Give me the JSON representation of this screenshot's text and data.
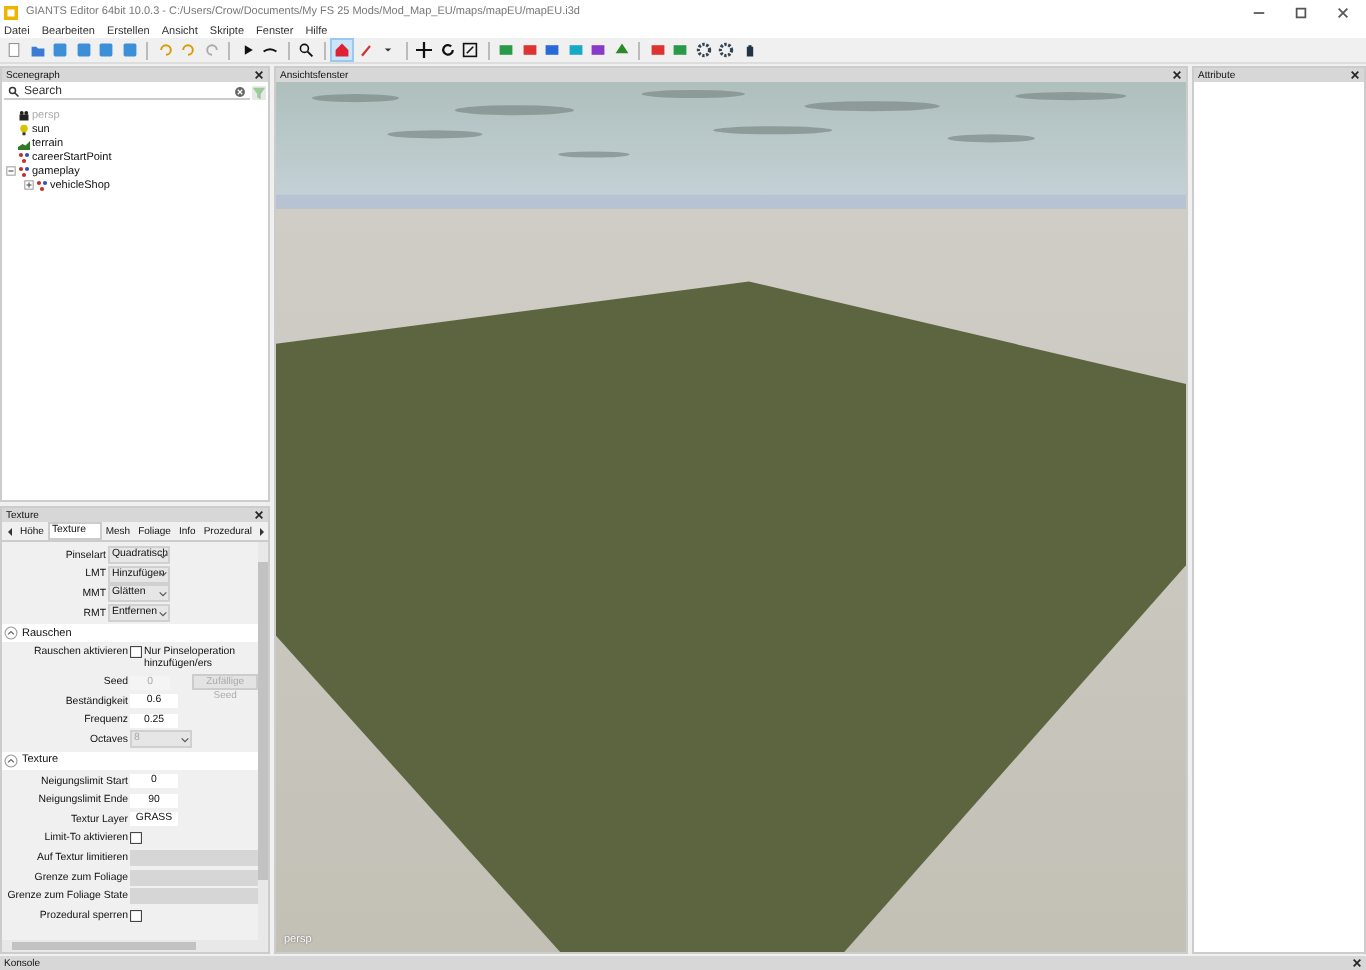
{
  "window": {
    "title": "GIANTS Editor 64bit 10.0.3 - C:/Users/Crow/Documents/My FS 25 Mods/Mod_Map_EU/maps/mapEU/mapEU.i3d"
  },
  "menu": [
    "Datei",
    "Bearbeiten",
    "Erstellen",
    "Ansicht",
    "Skripte",
    "Fenster",
    "Hilfe"
  ],
  "scenegraph": {
    "title": "Scenegraph",
    "search": {
      "placeholder": "Search"
    },
    "nodes": [
      {
        "label": "persp",
        "kind": "camera",
        "dimmed": true
      },
      {
        "label": "sun",
        "kind": "light",
        "dimmed": false
      },
      {
        "label": "terrain",
        "kind": "terrain",
        "dimmed": false
      },
      {
        "label": "careerStartPoint",
        "kind": "transform",
        "dimmed": false
      },
      {
        "label": "gameplay",
        "kind": "transform",
        "dimmed": false,
        "expanded": true,
        "children": [
          {
            "label": "vehicleShop",
            "kind": "transform",
            "dimmed": false,
            "expanded": false
          }
        ]
      }
    ]
  },
  "texture": {
    "title": "Texture",
    "tabs": [
      {
        "label": "Höhe",
        "selected": false
      },
      {
        "label": "Texture",
        "selected": true
      },
      {
        "label": "Mesh",
        "selected": false
      },
      {
        "label": "Foliage",
        "selected": false
      },
      {
        "label": "Info",
        "selected": false
      },
      {
        "label": "Prozedural",
        "selected": false
      }
    ],
    "sections": [
      {
        "rows": [
          {
            "kind": "select",
            "label": "Pinselart",
            "value": "Quadratisch",
            "disabled": false
          },
          {
            "kind": "select",
            "label": "LMT",
            "value": "Hinzufügen",
            "disabled": false
          },
          {
            "kind": "select",
            "label": "MMT",
            "value": "Glätten",
            "disabled": false
          },
          {
            "kind": "select",
            "label": "RMT",
            "value": "Entfernen",
            "disabled": false
          }
        ]
      },
      {
        "title": "Rauschen",
        "expanded": true,
        "rows": [
          {
            "kind": "checkbox",
            "label": "Rauschen aktivieren",
            "checked": false,
            "note": "Nur Pinseloperation hinzufügen/ers"
          },
          {
            "kind": "input",
            "label": "Seed",
            "value": "0",
            "disabled": true,
            "button": {
              "label": "Zufällige Seed",
              "disabled": true
            }
          },
          {
            "kind": "input",
            "label": "Beständigkeit",
            "value": "0.6",
            "disabled": false
          },
          {
            "kind": "input",
            "label": "Frequenz",
            "value": "0.25",
            "disabled": false
          },
          {
            "kind": "select",
            "label": "Octaves",
            "value": "8",
            "disabled": true
          }
        ]
      },
      {
        "title": "Texture",
        "expanded": true,
        "rows": [
          {
            "kind": "input",
            "label": "Neigungslimit Start",
            "value": "0",
            "disabled": false
          },
          {
            "kind": "input",
            "label": "Neigungslimit Ende",
            "value": "90",
            "disabled": false
          },
          {
            "kind": "input",
            "label": "Textur Layer",
            "value": "GRASS",
            "disabled": false
          },
          {
            "kind": "checkbox",
            "label": "Limit-To aktivieren",
            "checked": false
          },
          {
            "kind": "field",
            "label": "Auf Textur limitieren"
          },
          {
            "kind": "field",
            "label": "Grenze zum Foliage"
          },
          {
            "kind": "field",
            "label": "Grenze zum Foliage State"
          },
          {
            "kind": "checkbox",
            "label": "Prozedural sperren",
            "checked": false
          }
        ]
      }
    ]
  },
  "viewport": {
    "title": "Ansichtsfenster",
    "camera": "persp"
  },
  "attributes": {
    "title": "Attribute"
  },
  "console": {
    "title": "Konsole"
  }
}
